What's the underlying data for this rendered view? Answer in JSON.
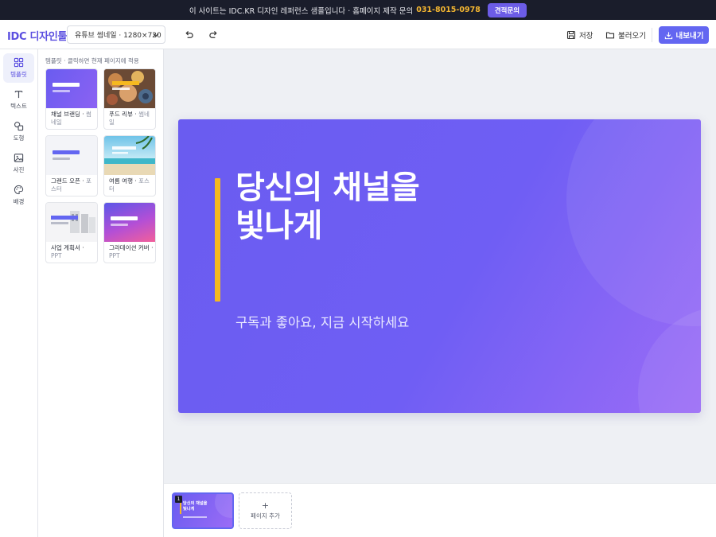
{
  "banner": {
    "text": "이 사이트는 IDC.KR 디자인 레퍼런스 샘플입니다 · 홈페이지 제작 문의",
    "phone": "031-8015-0978",
    "cta": "견적문의"
  },
  "header": {
    "logo": "IDC 디자인툴",
    "size_select": "유튜브 썸네일 · 1280×720",
    "save": "저장",
    "load": "불러오기",
    "export": "내보내기"
  },
  "rail": [
    {
      "label": "템플릿",
      "icon": "grid-icon",
      "active": true
    },
    {
      "label": "텍스트",
      "icon": "text-icon",
      "active": false
    },
    {
      "label": "도형",
      "icon": "shapes-icon",
      "active": false
    },
    {
      "label": "사진",
      "icon": "image-icon",
      "active": false
    },
    {
      "label": "배경",
      "icon": "palette-icon",
      "active": false
    }
  ],
  "templates": {
    "hint": "템플릿 · 클릭하면 현재 페이지에 적용",
    "items": [
      {
        "name": "채널 브랜딩",
        "type": "썸네일"
      },
      {
        "name": "푸드 리뷰",
        "type": "썸네일"
      },
      {
        "name": "그랜드 오픈",
        "type": "포스터"
      },
      {
        "name": "여름 여행",
        "type": "포스터"
      },
      {
        "name": "사업 계획서",
        "type": "PPT"
      },
      {
        "name": "그라데이션 커버",
        "type": "PPT"
      }
    ]
  },
  "slide": {
    "headline_line1": "당신의 채널을",
    "headline_line2": "빛나게",
    "subtitle": "구독과 좋아요, 지금 시작하세요"
  },
  "pages": {
    "current_number": "1",
    "thumb_title_line1": "당신의 채널을",
    "thumb_title_line2": "빛나게",
    "add_label": "페이지 추가"
  },
  "colors": {
    "accent": "#6366f1",
    "brand": "#5b4fe0",
    "highlight": "#f6b91f",
    "banner_bg": "#1a1d2b"
  }
}
